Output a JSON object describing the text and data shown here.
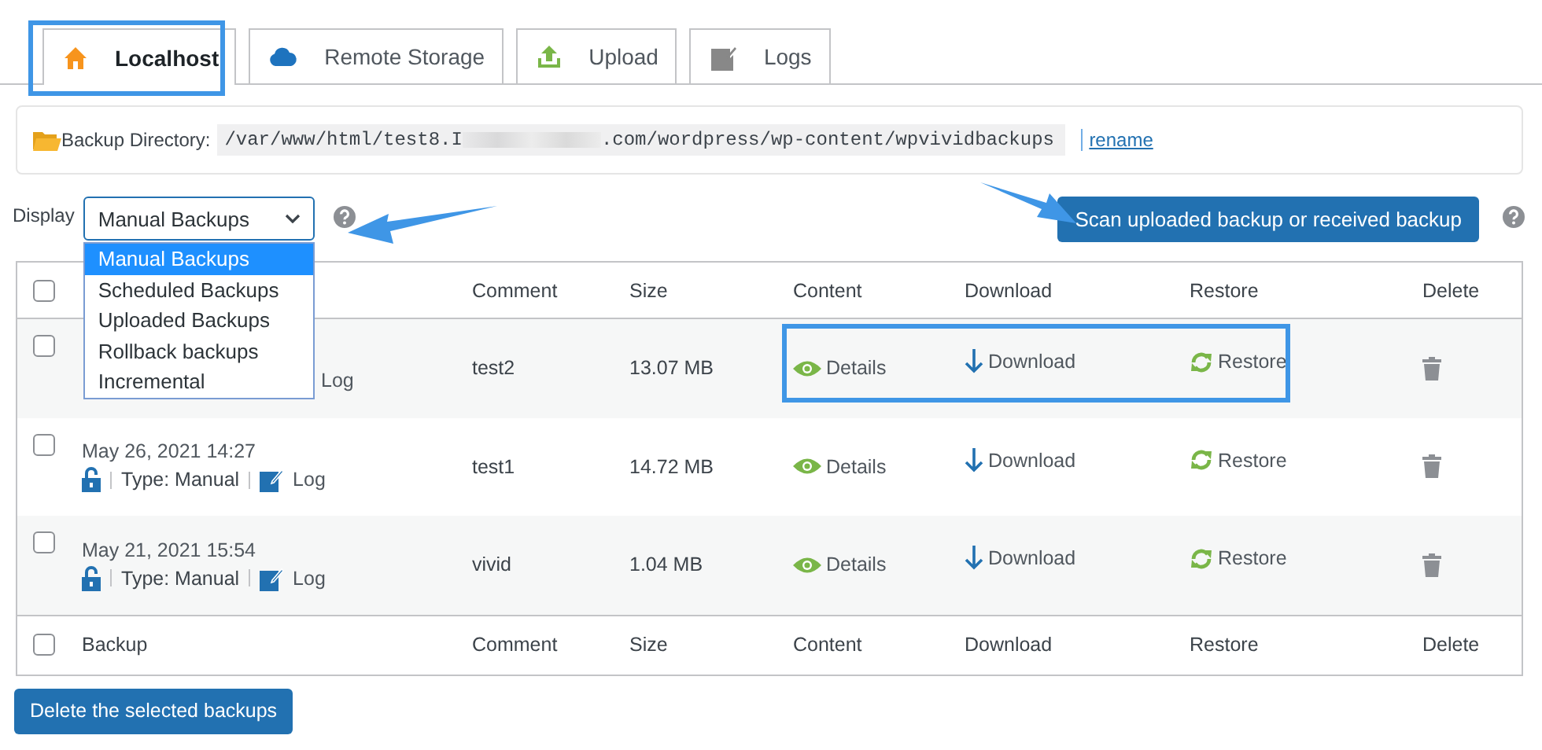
{
  "tabs": [
    {
      "label": "Localhost",
      "selected": true
    },
    {
      "label": "Remote Storage",
      "selected": false
    },
    {
      "label": "Upload",
      "selected": false
    },
    {
      "label": "Logs",
      "selected": false
    }
  ],
  "backup_directory": {
    "label": "Backup Directory:",
    "path_start": "/var/www/html/test8.I",
    "path_end": ".com/wordpress/wp-content/wpvividbackups",
    "link": "rename"
  },
  "display": {
    "label": "Display",
    "value": "Manual Backups",
    "expanded": true,
    "options": [
      {
        "label": "Manual Backups",
        "selected": true
      },
      {
        "label": "Scheduled Backups",
        "selected": false
      },
      {
        "label": "Uploaded Backups",
        "selected": false
      },
      {
        "label": "Rollback backups",
        "selected": false
      },
      {
        "label": "Incremental",
        "selected": false
      }
    ]
  },
  "scan_button": "Scan uploaded backup or received backup",
  "table": {
    "header": {
      "checked": false,
      "comment": "Comment",
      "size": "Size",
      "content": "Content",
      "download": "Download",
      "restore": "Restore",
      "delete": "Delete"
    },
    "rows": [
      {
        "checked": false,
        "log": "Log",
        "comment": "test2",
        "size": "13.07 MB",
        "details": "Details",
        "download": "Download",
        "restore": "Restore"
      },
      {
        "checked": false,
        "date": "May 26, 2021 14:27",
        "type": "Type: Manual",
        "log": "Log",
        "comment": "test1",
        "size": "14.72 MB",
        "details": "Details",
        "download": "Download",
        "restore": "Restore"
      },
      {
        "checked": false,
        "date": "May 21, 2021 15:54",
        "type": "Type: Manual",
        "log": "Log",
        "comment": "vivid",
        "size": "1.04 MB",
        "details": "Details",
        "download": "Download",
        "restore": "Restore"
      }
    ],
    "footer": {
      "checked": false,
      "backup": "Backup",
      "comment": "Comment",
      "size": "Size",
      "content": "Content",
      "download": "Download",
      "restore": "Restore",
      "delete": "Delete"
    }
  },
  "delete_button": "Delete the selected backups"
}
